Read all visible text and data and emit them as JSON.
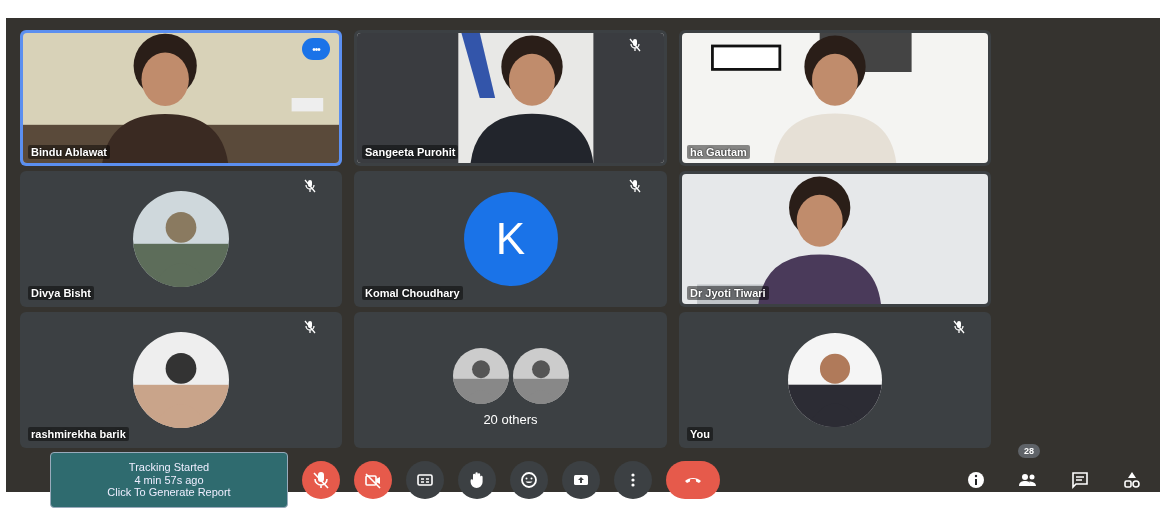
{
  "tiles": [
    {
      "name": "Bindu Ablawat",
      "kind": "video",
      "muted": false,
      "selected": true,
      "menu": "•••"
    },
    {
      "name": "Sangeeta Purohit",
      "kind": "video",
      "muted": true,
      "selected": false
    },
    {
      "name": "ha Gautam",
      "kind": "video",
      "muted": false,
      "selected": false
    },
    {
      "name": "Divya Bisht",
      "muted": true,
      "selected": false
    },
    {
      "name": "Komal Choudhary",
      "kind": "letter",
      "letter": "K",
      "muted": true,
      "selected": false
    },
    {
      "name": "Dr Jyoti Tiwari",
      "kind": "video",
      "muted": false,
      "selected": false
    },
    {
      "name": "rashmirekha barik",
      "muted": true,
      "selected": false
    },
    {
      "name": "20 others",
      "kind": "group",
      "muted": false,
      "selected": false
    },
    {
      "name": "You",
      "muted": true,
      "selected": false
    }
  ],
  "tracking": {
    "lines": [
      "Tracking Started",
      "4 min 57s ago",
      "Click To Generate Report"
    ]
  },
  "controls": [
    {
      "kind": "mic",
      "off": true
    },
    {
      "kind": "camera",
      "off": true
    },
    {
      "kind": "captions",
      "off": false
    },
    {
      "kind": "hand",
      "off": false
    },
    {
      "kind": "emoji",
      "off": false
    },
    {
      "kind": "present",
      "off": false
    },
    {
      "kind": "more",
      "off": false
    },
    {
      "kind": "hangup",
      "off": true
    }
  ],
  "side_controls": [
    {
      "kind": "info"
    },
    {
      "kind": "people",
      "badge": "28"
    },
    {
      "kind": "chat"
    },
    {
      "kind": "activities"
    }
  ]
}
